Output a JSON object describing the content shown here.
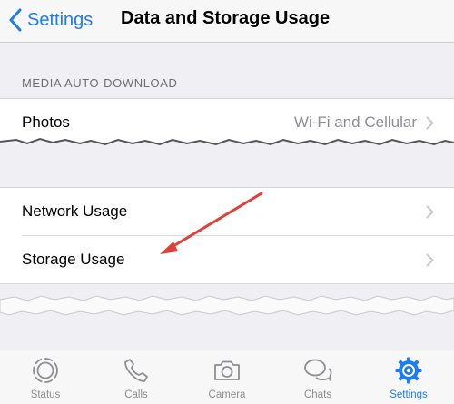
{
  "navbar": {
    "back_label": "Settings",
    "title": "Data and Storage Usage"
  },
  "media_section": {
    "header": "MEDIA AUTO-DOWNLOAD",
    "rows": [
      {
        "label": "Photos",
        "value": "Wi-Fi and Cellular"
      }
    ]
  },
  "usage_section": {
    "rows": [
      {
        "label": "Network Usage"
      },
      {
        "label": "Storage Usage"
      }
    ]
  },
  "tabbar": {
    "tabs": [
      {
        "label": "Status",
        "icon": "status-icon",
        "active": false
      },
      {
        "label": "Calls",
        "icon": "phone-icon",
        "active": false
      },
      {
        "label": "Camera",
        "icon": "camera-icon",
        "active": false
      },
      {
        "label": "Chats",
        "icon": "chat-bubbles-icon",
        "active": false
      },
      {
        "label": "Settings",
        "icon": "gear-icon",
        "active": true
      }
    ]
  },
  "colors": {
    "accent": "#1b7cf6",
    "background": "#efeff4",
    "annotation_arrow": "#e0403a"
  }
}
